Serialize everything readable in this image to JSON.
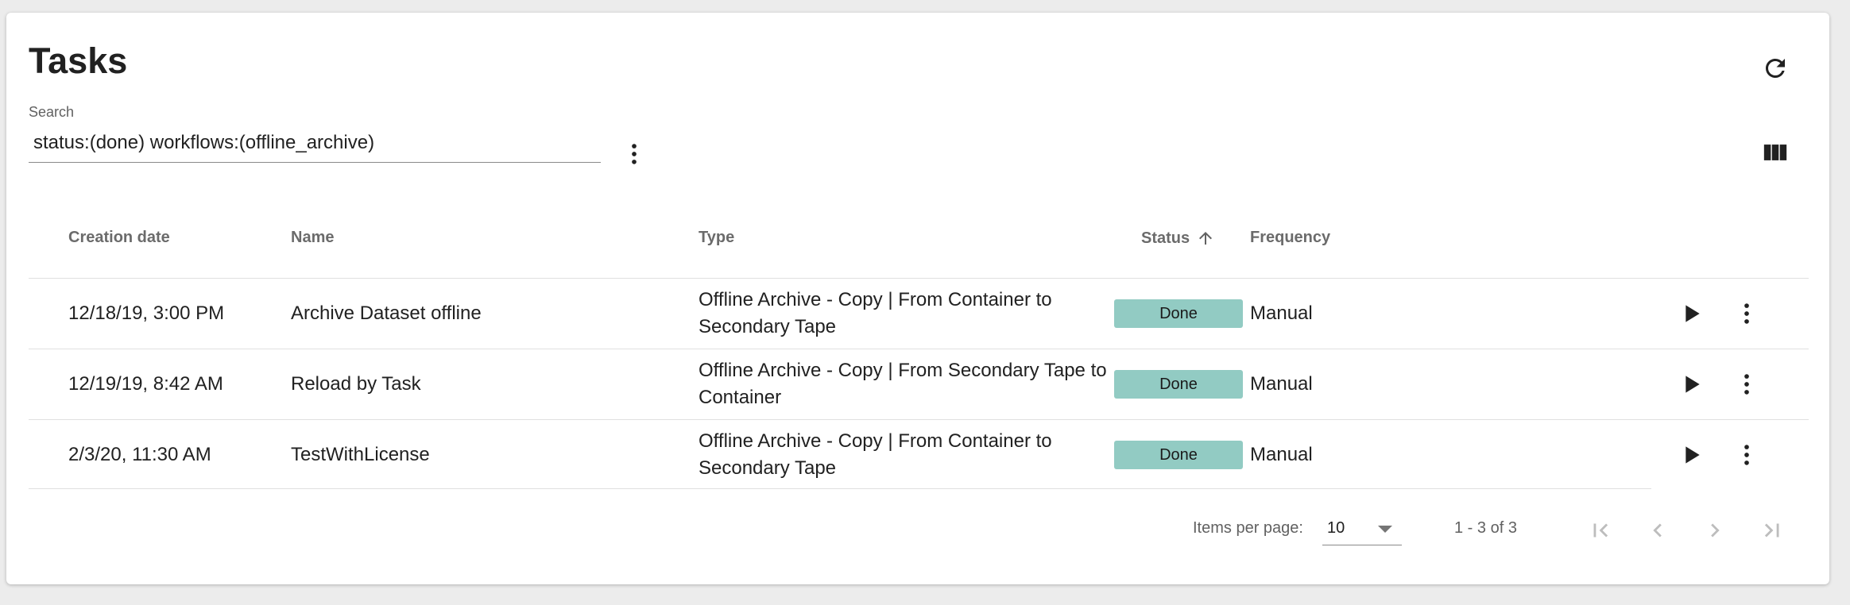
{
  "page": {
    "title": "Tasks"
  },
  "toolbar": {
    "refresh_icon": "refresh-icon",
    "columns_icon": "view-columns-icon",
    "search_menu_icon": "more-vertical-icon"
  },
  "search": {
    "label": "Search",
    "value": "status:(done) workflows:(offline_archive)"
  },
  "table": {
    "columns": [
      "Creation date",
      "Name",
      "Type",
      "Status",
      "Frequency"
    ],
    "sort": {
      "column": "Status",
      "direction": "ascending",
      "icon": "arrow-up-icon"
    },
    "rows": [
      {
        "creation_date": "12/18/19, 3:00 PM",
        "name": "Archive Dataset offline",
        "type": "Offline Archive - Copy | From Container to Secondary Tape",
        "status": "Done",
        "frequency": "Manual"
      },
      {
        "creation_date": "12/19/19, 8:42 AM",
        "name": "Reload by Task",
        "type": "Offline Archive - Copy | From Secondary Tape to Container",
        "status": "Done",
        "frequency": "Manual"
      },
      {
        "creation_date": "2/3/20, 11:30 AM",
        "name": "TestWithLicense",
        "type": "Offline Archive - Copy | From Container to Secondary Tape",
        "status": "Done",
        "frequency": "Manual"
      }
    ],
    "row_actions": {
      "run_icon": "play-icon",
      "menu_icon": "more-vertical-icon"
    }
  },
  "paginator": {
    "items_per_page_label": "Items per page:",
    "items_per_page_value": "10",
    "range_label": "1 - 3 of 3",
    "icons": [
      "first-page-icon",
      "previous-page-icon",
      "next-page-icon",
      "last-page-icon"
    ]
  },
  "colors": {
    "status_done_bg": "#92cbc3",
    "background": "#ececec",
    "card": "#ffffff"
  }
}
